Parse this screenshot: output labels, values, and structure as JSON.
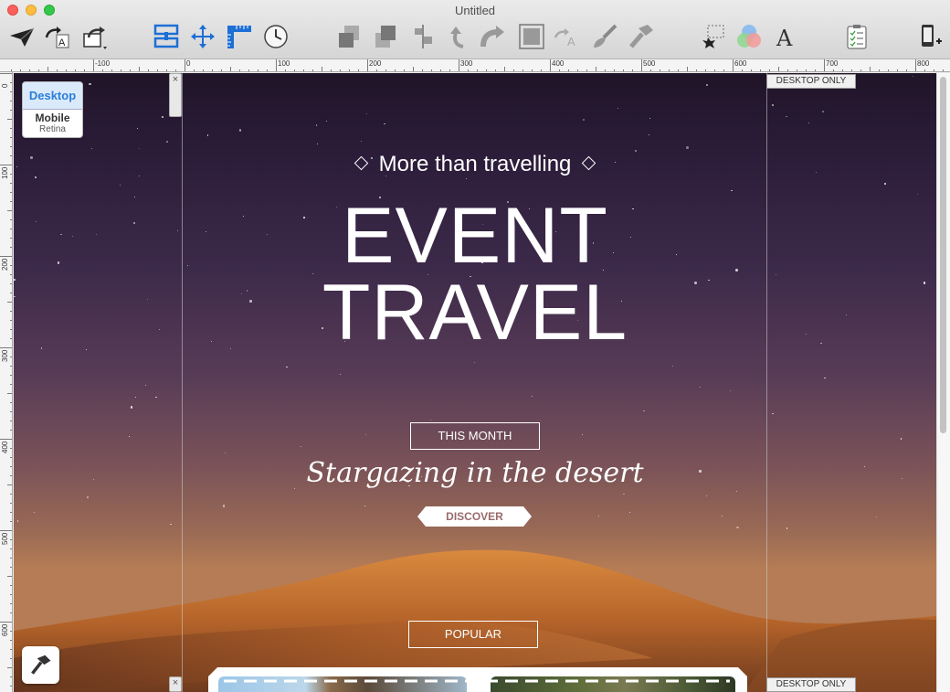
{
  "window": {
    "title": "Untitled"
  },
  "toolbar": {
    "icons": [
      "paper-plane-icon",
      "redo-text-icon",
      "share-arrow-icon",
      "layout-rows-icon",
      "move-arrows-icon",
      "ruler-icon",
      "clock-icon",
      "send-back-icon",
      "bring-front-icon",
      "align-icon",
      "rotate-icon",
      "redo-arrow-icon",
      "group-icon",
      "text-redo-icon",
      "brush-icon",
      "hammer-icon",
      "magic-select-icon",
      "color-circles-icon",
      "font-icon",
      "checklist-icon",
      "device-add-icon"
    ]
  },
  "ruler": {
    "h_labels": [
      "-100",
      "0",
      "100",
      "200",
      "300",
      "400",
      "500",
      "600",
      "700",
      "800"
    ],
    "v_labels": [
      "0",
      "100",
      "200",
      "300",
      "400",
      "500",
      "600"
    ]
  },
  "device": {
    "desktop": "Desktop",
    "mobile": "Mobile",
    "retina": "Retina"
  },
  "hero": {
    "subtitle": "More than travelling",
    "title_line1": "EVENT",
    "title_line2": "TRAVEL",
    "badge": "THIS MONTH",
    "script_text": "Stargazing in the desert",
    "discover": "DISCOVER",
    "popular": "POPULAR"
  },
  "labels": {
    "desktop_only_top": "DESKTOP ONLY",
    "desktop_only_bottom": "DESKTOP ONLY",
    "close_x": "×"
  }
}
